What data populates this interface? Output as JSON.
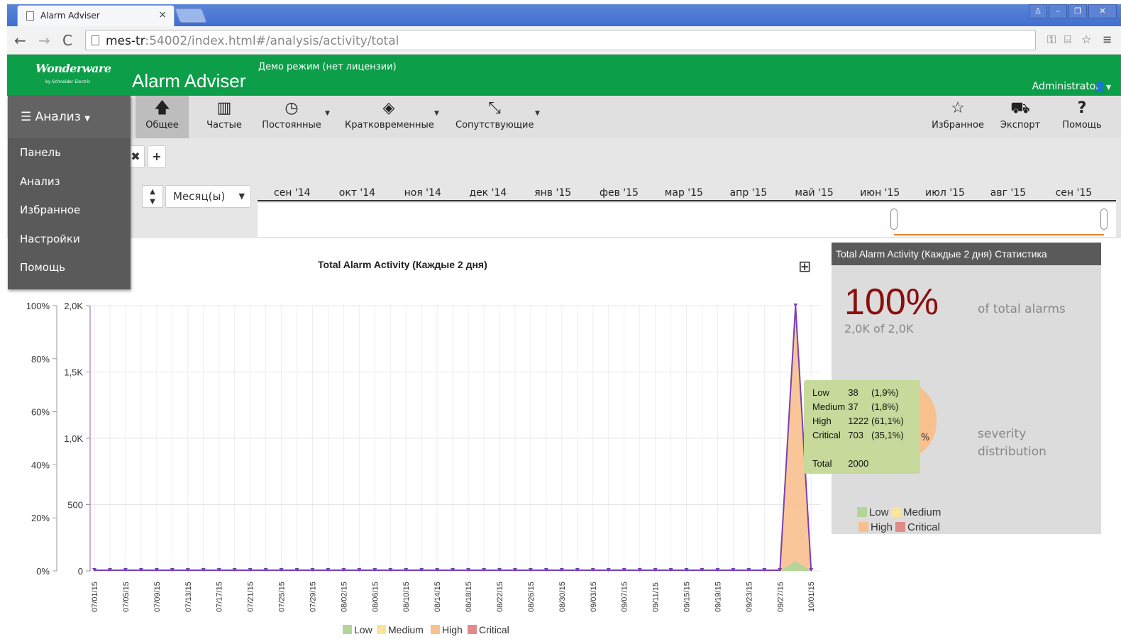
{
  "browser": {
    "tab_title": "Alarm Adviser",
    "tab_close": "×",
    "url_host": "mes-tr",
    "url_rest": ":54002/index.html#/analysis/activity/total"
  },
  "header": {
    "logo_text": "Wonderware",
    "logo_sub": "by Schneider Electric",
    "app_title": "Alarm Adviser",
    "demo_text": "Демо режим (нет лицензии)",
    "user": "Administrator",
    "brand_color": "#0c9e48"
  },
  "menu": {
    "title": "Анализ",
    "items": [
      "Панель",
      "Анализ",
      "Избранное",
      "Настройки",
      "Помощь"
    ]
  },
  "toolbar": {
    "buttons": [
      {
        "label": "Общее",
        "icon": "arrow-up-icon",
        "active": true
      },
      {
        "label": "Частые",
        "icon": "bar-chart-icon"
      },
      {
        "label": "Постоянные",
        "icon": "clock-icon"
      },
      {
        "label": "Кратковременные",
        "icon": "eye-slash-icon"
      },
      {
        "label": "Сопутствующие",
        "icon": "compress-icon"
      }
    ],
    "right_buttons": [
      {
        "label": "Избранное",
        "icon": "star-icon"
      },
      {
        "label": "Экспорт",
        "icon": "truck-icon"
      },
      {
        "label": "Помощь",
        "icon": "question-icon"
      }
    ]
  },
  "timeline": {
    "period": "Месяц(ы)",
    "months": [
      "сен '14",
      "окт '14",
      "ноя '14",
      "дек '14",
      "янв '15",
      "фев '15",
      "мар '15",
      "апр '15",
      "май '15",
      "июн '15",
      "июл '15",
      "авг '15",
      "сен '15"
    ]
  },
  "chart_data": {
    "type": "area",
    "title": "Total Alarm Activity (Каждые 2 дня)",
    "y_left_ticks": [
      "100%",
      "80%",
      "60%",
      "40%",
      "20%",
      "0%"
    ],
    "y_right_ticks": [
      "2,0K",
      "1,5K",
      "1,0K",
      "500",
      "0"
    ],
    "ylim": [
      0,
      2000
    ],
    "x_tick_labels": [
      "07/01/15",
      "07/05/15",
      "07/09/15",
      "07/13/15",
      "07/17/15",
      "07/21/15",
      "07/25/15",
      "07/29/15",
      "08/02/15",
      "08/06/15",
      "08/10/15",
      "08/14/15",
      "08/18/15",
      "08/22/15",
      "08/26/15",
      "08/30/15",
      "09/03/15",
      "09/07/15",
      "09/11/15",
      "09/15/15",
      "09/19/15",
      "09/23/15",
      "09/27/15",
      "10/01/15"
    ],
    "series": [
      {
        "name": "Low",
        "color": "#b5d49a"
      },
      {
        "name": "Medium",
        "color": "#f8e49a"
      },
      {
        "name": "High",
        "color": "#f7c08e"
      },
      {
        "name": "Critical",
        "color": "#e08a8a"
      }
    ],
    "total_points": 47,
    "peak_index": 45,
    "peak_value": 2000
  },
  "stats": {
    "title": "Total Alarm Activity (Каждые 2 дня) Статистика",
    "percent": "100%",
    "count_text": "2,0K of 2,0K",
    "of_total": "of total alarms",
    "severity_text": "severity distribution",
    "pie_label": "%",
    "tooltip": {
      "rows": [
        {
          "name": "Low",
          "count": "38",
          "pct": "(1,9%)"
        },
        {
          "name": "Medium",
          "count": "37",
          "pct": "(1,8%)"
        },
        {
          "name": "High",
          "count": "1222",
          "pct": "(61,1%)"
        },
        {
          "name": "Critical",
          "count": "703",
          "pct": "(35,1%)"
        }
      ],
      "total_label": "Total",
      "total": "2000"
    }
  }
}
